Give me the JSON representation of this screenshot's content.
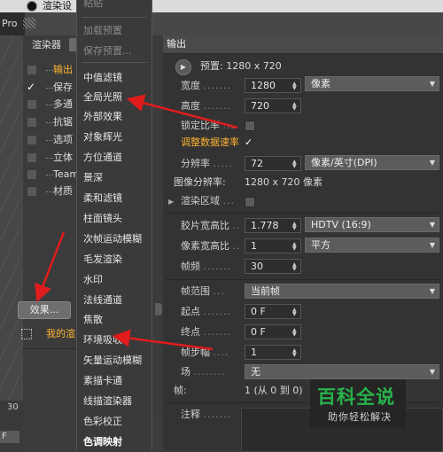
{
  "titlebar": {
    "title": "渲染设"
  },
  "app_tab": "Pro",
  "left_panel": {
    "renderer_label": "渲染器",
    "tree": [
      {
        "label": "输出",
        "checked": false,
        "active": true
      },
      {
        "label": "保存",
        "checked": true,
        "active": false
      },
      {
        "label": "多通",
        "checked": false,
        "active": false
      },
      {
        "label": "抗锯",
        "checked": false,
        "active": false
      },
      {
        "label": "选项",
        "checked": false,
        "active": false
      },
      {
        "label": "立体",
        "checked": false,
        "active": false
      },
      {
        "label": "Team",
        "checked": false,
        "active": false
      },
      {
        "label": "材质",
        "checked": false,
        "active": false
      }
    ],
    "effects_button": "效果...",
    "multi_pass_item": "我的渲",
    "bottom_number": "30",
    "bottom_f": "F"
  },
  "menu": {
    "items": [
      {
        "label": "粘贴",
        "disabled": true
      },
      {
        "label": "加载预置",
        "disabled": true
      },
      {
        "label": "保存预置...",
        "disabled": true
      },
      {
        "label": "中值滤镜",
        "disabled": false
      },
      {
        "label": "全局光照",
        "disabled": false
      },
      {
        "label": "外部效果",
        "disabled": false
      },
      {
        "label": "对象辉光",
        "disabled": false
      },
      {
        "label": "方位通道",
        "disabled": false
      },
      {
        "label": "景深",
        "disabled": false
      },
      {
        "label": "柔和滤镜",
        "disabled": false
      },
      {
        "label": "柱面镜头",
        "disabled": false
      },
      {
        "label": "次帧运动模糊",
        "disabled": false
      },
      {
        "label": "毛发渲染",
        "disabled": false
      },
      {
        "label": "水印",
        "disabled": false
      },
      {
        "label": "法线通道",
        "disabled": false
      },
      {
        "label": "焦散",
        "disabled": false
      },
      {
        "label": "环境吸收",
        "disabled": false
      },
      {
        "label": "矢量运动模糊",
        "disabled": false
      },
      {
        "label": "素描卡通",
        "disabled": false
      },
      {
        "label": "线描渲染器",
        "disabled": false
      },
      {
        "label": "色彩校正",
        "disabled": false
      },
      {
        "label": "色调映射",
        "disabled": false
      }
    ]
  },
  "output": {
    "header": "输出",
    "preset_label": "预置: 1280 x 720",
    "width_label": "宽度",
    "width_value": "1280",
    "width_unit": "像素",
    "height_label": "高度",
    "height_value": "720",
    "lock_ratio_label": "锁定比率",
    "adjust_rate_label": "调整数据速率",
    "adjust_rate_check": "✓",
    "resolution_label": "分辨率",
    "resolution_value": "72",
    "resolution_unit": "像素/英寸(DPI)",
    "image_res_label": "图像分辨率:",
    "image_res_value": "1280 x 720 像素",
    "render_region_label": "渲染区域",
    "film_aspect_label": "胶片宽高比",
    "film_aspect_value": "1.778",
    "film_aspect_preset": "HDTV (16:9)",
    "pixel_aspect_label": "像素宽高比",
    "pixel_aspect_value": "1",
    "pixel_aspect_preset": "平方",
    "fps_label": "帧频",
    "fps_value": "30",
    "frame_range_label": "帧范围",
    "frame_range_value": "当前帧",
    "start_label": "起点",
    "start_value": "0 F",
    "end_label": "终点",
    "end_value": "0 F",
    "frame_step_label": "帧步幅",
    "frame_step_value": "1",
    "field_label": "场",
    "field_value": "无",
    "frames_label": "帧:",
    "frames_value": "1 (从 0 到 0)",
    "notes_label": "注释"
  },
  "watermark": {
    "title": "百科全说",
    "subtitle": "助你轻松解决"
  },
  "colors": {
    "accent_orange": "#ffb431",
    "arrow_red": "#e01c1c",
    "watermark_green": "#28b24b"
  }
}
